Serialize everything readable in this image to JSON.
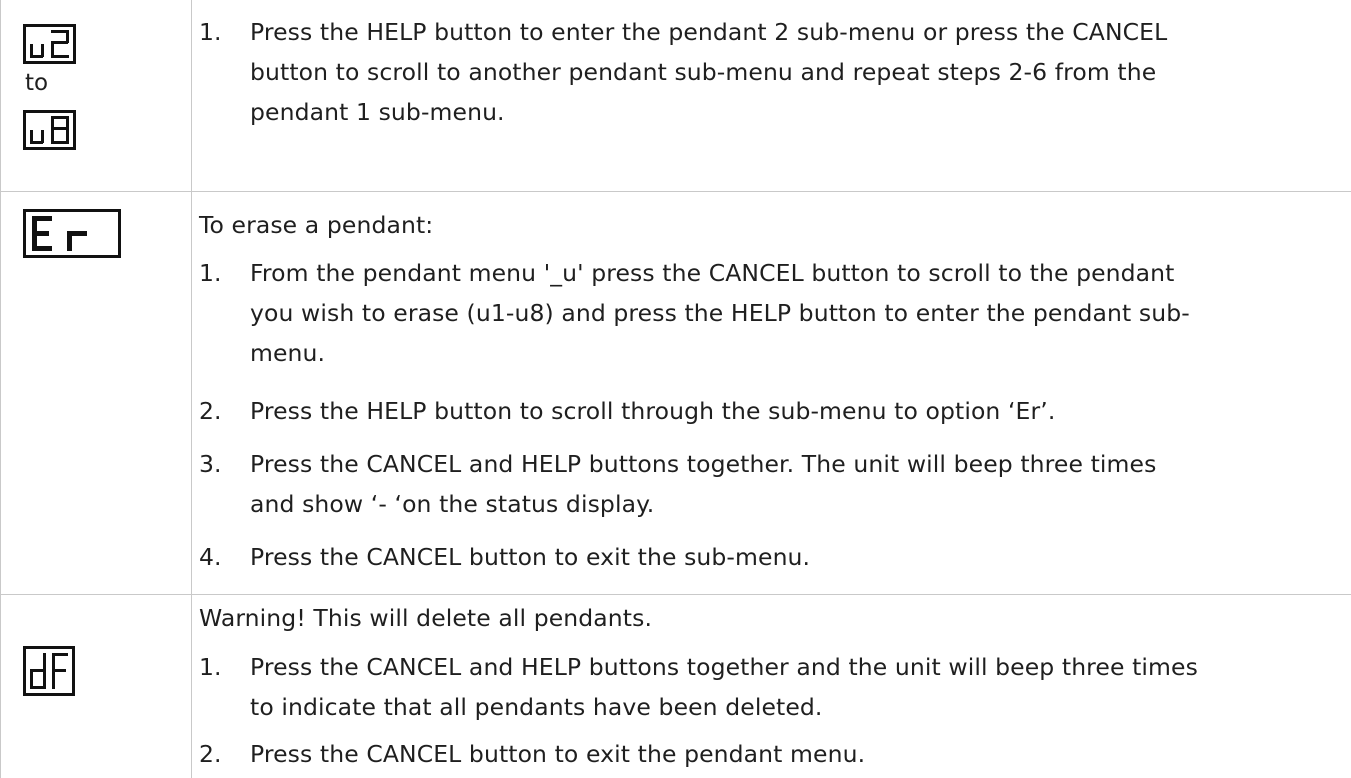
{
  "rows": [
    {
      "icons": [
        "u2",
        "u8"
      ],
      "to_label": "to",
      "items": [
        {
          "number": "1.",
          "lines": [
            "Press the HELP button to enter the pendant 2 sub-menu or press the CANCEL",
            "button to scroll to another pendant sub-menu and repeat steps 2-6 from the",
            "pendant 1 sub-menu."
          ]
        }
      ]
    },
    {
      "icons": [
        "Er"
      ],
      "intro": "To erase a pendant:",
      "items": [
        {
          "number": "1.",
          "lines": [
            "From the pendant menu '_u' press the CANCEL button to scroll to the pendant",
            "you wish to erase (u1-u8) and press the HELP button to enter the pendant sub-",
            "menu."
          ]
        },
        {
          "number": "2.",
          "lines": [
            "Press the HELP button to scroll through the sub-menu to option ‘Er’."
          ]
        },
        {
          "number": "3.",
          "lines": [
            "Press the CANCEL and HELP buttons together. The unit will beep three times",
            "and show ‘- ‘on the status display."
          ]
        },
        {
          "number": "4.",
          "lines": [
            "Press the CANCEL button to exit the sub-menu."
          ]
        }
      ]
    },
    {
      "icons": [
        "dF"
      ],
      "intro": "Warning! This will delete all pendants.",
      "items": [
        {
          "number": "1.",
          "lines": [
            "Press the CANCEL and HELP buttons together and the unit will beep three times",
            "to indicate that all pendants have been deleted."
          ]
        },
        {
          "number": "2.",
          "lines": [
            "Press the CANCEL button to exit the pendant menu."
          ]
        }
      ]
    }
  ]
}
